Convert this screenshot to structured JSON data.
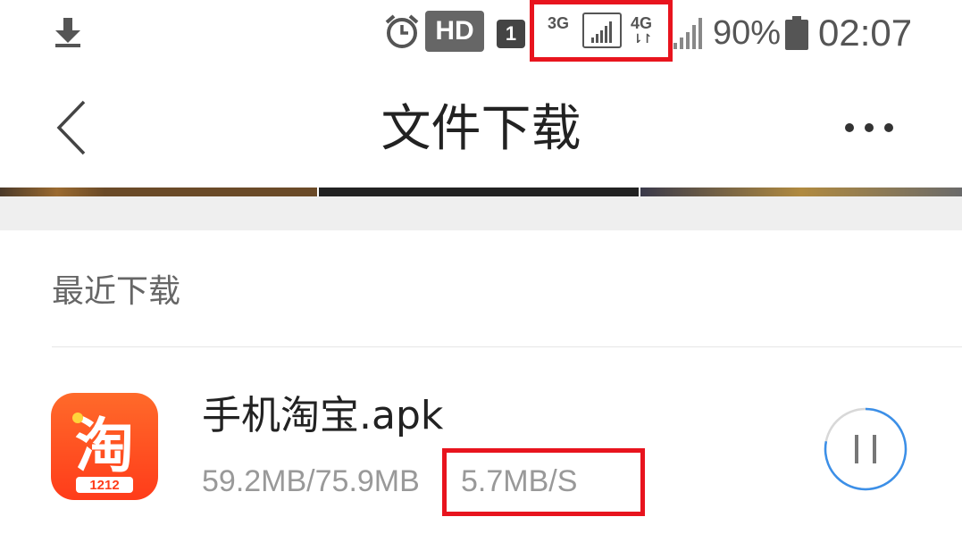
{
  "status_bar": {
    "download_icon": "download-arrow-icon",
    "alarm_icon": "alarm-clock-icon",
    "hd_label": "HD",
    "sim_label": "1",
    "net_3g_label": "3G",
    "net_4g_label": "4G",
    "net_4g_arrows": "⇂↾",
    "battery_percent": "90%",
    "time": "02:07"
  },
  "header": {
    "back_icon": "chevron-left-icon",
    "title": "文件下载",
    "more_icon": "more-dots-icon"
  },
  "section": {
    "title": "最近下载"
  },
  "downloads": [
    {
      "app_icon_label": "淘",
      "app_icon_badge": "1212",
      "name": "手机淘宝.apk",
      "progress": "59.2MB/75.9MB",
      "speed": "5.7MB/S",
      "progress_fraction": 0.78,
      "control_icon": "pause-icon"
    }
  ],
  "colors": {
    "highlight": "#e8141e",
    "progress_ring": "#3b8fe8",
    "app_icon_bg": "#ff5a1f",
    "gray_text": "#999999"
  }
}
